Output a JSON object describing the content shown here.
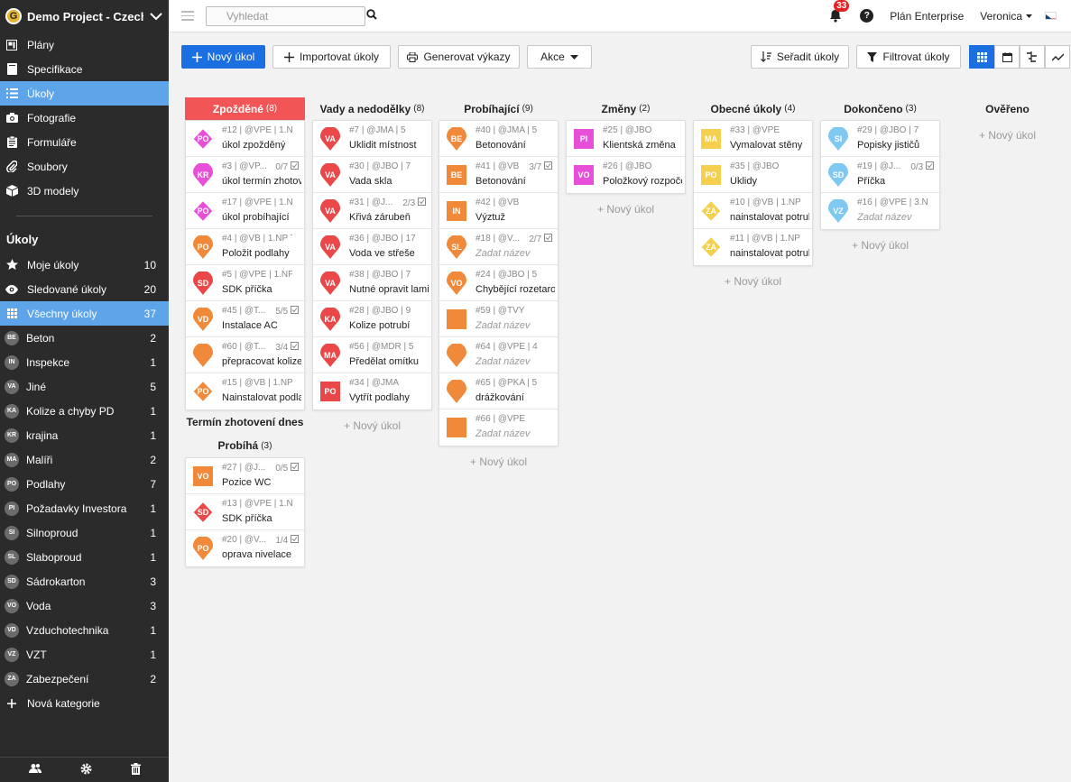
{
  "sidebar": {
    "project": "Demo Project - Czech",
    "logo": "G",
    "nav": [
      {
        "label": "Plány",
        "icon": "plan-icon"
      },
      {
        "label": "Specifikace",
        "icon": "book-icon"
      },
      {
        "label": "Úkoly",
        "icon": "list-icon"
      },
      {
        "label": "Fotografie",
        "icon": "camera-icon"
      },
      {
        "label": "Formuláře",
        "icon": "clipboard-icon"
      },
      {
        "label": "Soubory",
        "icon": "paperclip-icon"
      },
      {
        "label": "3D modely",
        "icon": "cube-icon"
      }
    ],
    "section_title": "Úkoly",
    "cats": [
      {
        "label": "Moje úkoly",
        "count": "10"
      },
      {
        "label": "Sledované úkoly",
        "count": "20"
      },
      {
        "label": "Všechny úkoly",
        "count": "37"
      },
      {
        "abbr": "BE",
        "label": "Beton",
        "count": "2"
      },
      {
        "abbr": "IN",
        "label": "Inspekce",
        "count": "1"
      },
      {
        "abbr": "VA",
        "label": "Jiné",
        "count": "5"
      },
      {
        "abbr": "KA",
        "label": "Kolize a chyby PD",
        "count": "1"
      },
      {
        "abbr": "KR",
        "label": "krajina",
        "count": "1"
      },
      {
        "abbr": "MA",
        "label": "Malíři",
        "count": "2"
      },
      {
        "abbr": "PO",
        "label": "Podlahy",
        "count": "7"
      },
      {
        "abbr": "PI",
        "label": "Požadavky Investora",
        "count": "1"
      },
      {
        "abbr": "SI",
        "label": "Silnoproud",
        "count": "1"
      },
      {
        "abbr": "SL",
        "label": "Slaboproud",
        "count": "1"
      },
      {
        "abbr": "SD",
        "label": "Sádrokarton",
        "count": "3"
      },
      {
        "abbr": "VO",
        "label": "Voda",
        "count": "3"
      },
      {
        "abbr": "VD",
        "label": "Vzduchotechnika",
        "count": "1"
      },
      {
        "abbr": "VZ",
        "label": "VZT",
        "count": "1"
      },
      {
        "abbr": "ZA",
        "label": "Zabezpečení",
        "count": "2"
      }
    ],
    "new_category": "Nová kategorie"
  },
  "topbar": {
    "search_placeholder": "Vyhledat",
    "notif_count": "33",
    "help": "?",
    "plan": "Plán Enterprise",
    "user": "Veronica"
  },
  "toolbar": {
    "new_task": "Nový úkol",
    "import": "Importovat úkoly",
    "reports": "Generovat výkazy",
    "actions": "Akce",
    "sort": "Seřadit úkoly",
    "filter": "Filtrovat úkoly"
  },
  "board": {
    "add_label": "+ Nový úkol",
    "col1": {
      "title": "Zpožděné",
      "count": "(8)",
      "cards": [
        {
          "meta": "#12 | @VPE | 1.N...",
          "title": "úkol zpožděný",
          "abbr": "PO",
          "shape": "diamond",
          "color": "#e84fd8",
          "check": ""
        },
        {
          "meta": "#3 | @VP...",
          "title": "úkol termín zhotovení",
          "abbr": "KR",
          "shape": "pin",
          "color": "#e84fd8",
          "check": "0/7"
        },
        {
          "meta": "#17 | @VPE | 1.N...",
          "title": "úkol probíhající",
          "abbr": "PO",
          "shape": "diamond",
          "color": "#e84fd8",
          "check": ""
        },
        {
          "meta": "#4 | @VB | 1.NP T...",
          "title": "Položit podlahy",
          "abbr": "PO",
          "shape": "pin",
          "color": "#f0893a",
          "check": ""
        },
        {
          "meta": "#5 | @VPE | 1.NP ...",
          "title": "SDK příčka",
          "abbr": "SD",
          "shape": "pin",
          "color": "#ea4848",
          "check": ""
        },
        {
          "meta": "#45 | @T...",
          "title": "Instalace AC",
          "abbr": "VD",
          "shape": "pin",
          "color": "#f0893a",
          "check": "5/5"
        },
        {
          "meta": "#60 | @T...",
          "title": "přepracovat kolize",
          "abbr": "",
          "shape": "pin",
          "color": "#f0893a",
          "check": "3/4"
        },
        {
          "meta": "#15 | @VB | 1.NP ...",
          "title": "Nainstalovat podlahy",
          "abbr": "PO",
          "shape": "diamond",
          "color": "#f0893a",
          "check": ""
        }
      ]
    },
    "col1b_title": "Termín zhotovení dnes",
    "col1c": {
      "title": "Probíhá",
      "count": "(3)",
      "cards": [
        {
          "meta": "#27 | @J...",
          "title": "Pozice WC",
          "abbr": "VO",
          "shape": "square",
          "color": "#f0893a",
          "check": "0/5"
        },
        {
          "meta": "#13 | @VPE | 1.N...",
          "title": "SDK příčka",
          "abbr": "SD",
          "shape": "diamond",
          "color": "#ea4848",
          "check": ""
        },
        {
          "meta": "#20 | @V...",
          "title": "oprava nivelace",
          "abbr": "PO",
          "shape": "pin",
          "color": "#f0893a",
          "check": "1/4"
        }
      ]
    },
    "col2": {
      "title": "Vady a nedodělky",
      "count": "(8)",
      "cards": [
        {
          "meta": "#7 | @JMA | 5",
          "title": "Uklidit místnost",
          "abbr": "VA",
          "shape": "pin",
          "color": "#ea4848",
          "check": ""
        },
        {
          "meta": "#30 | @JBO | 7",
          "title": "Vada skla",
          "abbr": "VA",
          "shape": "pin",
          "color": "#ea4848",
          "check": ""
        },
        {
          "meta": "#31 | @J...",
          "title": "Křivá zárubeň",
          "abbr": "VA",
          "shape": "pin",
          "color": "#ea4848",
          "check": "2/3"
        },
        {
          "meta": "#36 | @JBO | 17",
          "title": "Voda ve střeše",
          "abbr": "VA",
          "shape": "pin",
          "color": "#ea4848",
          "check": ""
        },
        {
          "meta": "#38 | @JBO | 7",
          "title": "Nutné opravit laminát",
          "abbr": "VA",
          "shape": "pin",
          "color": "#ea4848",
          "check": ""
        },
        {
          "meta": "#28 | @JBO | 9",
          "title": "Kolize potrubí",
          "abbr": "KA",
          "shape": "pin",
          "color": "#ea4848",
          "check": ""
        },
        {
          "meta": "#56 | @MDR | 5",
          "title": "Předělat omítku",
          "abbr": "MA",
          "shape": "pin",
          "color": "#ea4848",
          "check": ""
        },
        {
          "meta": "#34 | @JMA",
          "title": "Vytřít podlahy",
          "abbr": "PO",
          "shape": "square",
          "color": "#ea4848",
          "check": ""
        }
      ]
    },
    "col3": {
      "title": "Probíhající",
      "count": "(9)",
      "cards": [
        {
          "meta": "#40 | @JMA | 5",
          "title": "Betonování",
          "abbr": "BE",
          "shape": "pin",
          "color": "#f0893a",
          "check": ""
        },
        {
          "meta": "#41 | @VB",
          "title": "Betonování",
          "abbr": "BE",
          "shape": "square",
          "color": "#f0893a",
          "check": "3/7"
        },
        {
          "meta": "#42 | @VB",
          "title": "Výztuž",
          "abbr": "IN",
          "shape": "square",
          "color": "#f0893a",
          "check": ""
        },
        {
          "meta": "#18 | @V...",
          "title": "Zadat název",
          "abbr": "SL",
          "shape": "pin",
          "color": "#f0893a",
          "check": "2/7",
          "ph": true
        },
        {
          "meta": "#24 | @JBO | 5",
          "title": "Chybějící rozetarozvodů",
          "abbr": "VO",
          "shape": "pin",
          "color": "#f0893a",
          "check": ""
        },
        {
          "meta": "#59 | @TVY",
          "title": "Zadat název",
          "abbr": "",
          "shape": "square",
          "color": "#f0893a",
          "check": "",
          "ph": true
        },
        {
          "meta": "#64 | @VPE | 4",
          "title": "Zadat název",
          "abbr": "",
          "shape": "pin",
          "color": "#f0893a",
          "check": "",
          "ph": true
        },
        {
          "meta": "#65 | @PKA | 5",
          "title": "drážkování",
          "abbr": "",
          "shape": "pin",
          "color": "#f0893a",
          "check": ""
        },
        {
          "meta": "#66 | @VPE",
          "title": "Zadat název",
          "abbr": "",
          "shape": "square",
          "color": "#f0893a",
          "check": "",
          "ph": true
        }
      ]
    },
    "col4": {
      "title": "Změny",
      "count": "(2)",
      "cards": [
        {
          "meta": "#25 | @JBO",
          "title": "Klientská změna",
          "abbr": "PI",
          "shape": "square",
          "color": "#e84fd8",
          "check": ""
        },
        {
          "meta": "#26 | @JBO",
          "title": "Položkový rozpočet",
          "abbr": "VO",
          "shape": "square",
          "color": "#e84fd8",
          "check": ""
        }
      ]
    },
    "col5": {
      "title": "Obecné úkoly",
      "count": "(4)",
      "cards": [
        {
          "meta": "#33 | @VPE",
          "title": "Vymalovat stěny",
          "abbr": "MA",
          "shape": "square",
          "color": "#f5d04e",
          "check": ""
        },
        {
          "meta": "#35 | @JBO",
          "title": "Úklidy",
          "abbr": "PO",
          "shape": "square",
          "color": "#f5d04e",
          "check": ""
        },
        {
          "meta": "#10 | @VB | 1.NP ...",
          "title": "nainstalovat potrubí",
          "abbr": "ZA",
          "shape": "diamond",
          "color": "#f5d04e",
          "check": ""
        },
        {
          "meta": "#11 | @VB | 1.NP ...",
          "title": "nainstalovat potrubí",
          "abbr": "ZA",
          "shape": "diamond",
          "color": "#f5d04e",
          "check": ""
        }
      ]
    },
    "col6": {
      "title": "Dokončeno",
      "count": "(3)",
      "cards": [
        {
          "meta": "#29 | @JBO | 7",
          "title": "Popisky jističů",
          "abbr": "SI",
          "shape": "pin",
          "color": "#7ec8f2",
          "check": ""
        },
        {
          "meta": "#19 | @J...",
          "title": "Příčka",
          "abbr": "SD",
          "shape": "pin",
          "color": "#7ec8f2",
          "check": "0/3"
        },
        {
          "meta": "#16 | @VPE | 3.N...",
          "title": "Zadat název",
          "abbr": "VZ",
          "shape": "pin",
          "color": "#7ec8f2",
          "check": "",
          "ph": true
        }
      ]
    },
    "col7": {
      "title": "Ověřeno",
      "count": "",
      "cards": []
    }
  }
}
